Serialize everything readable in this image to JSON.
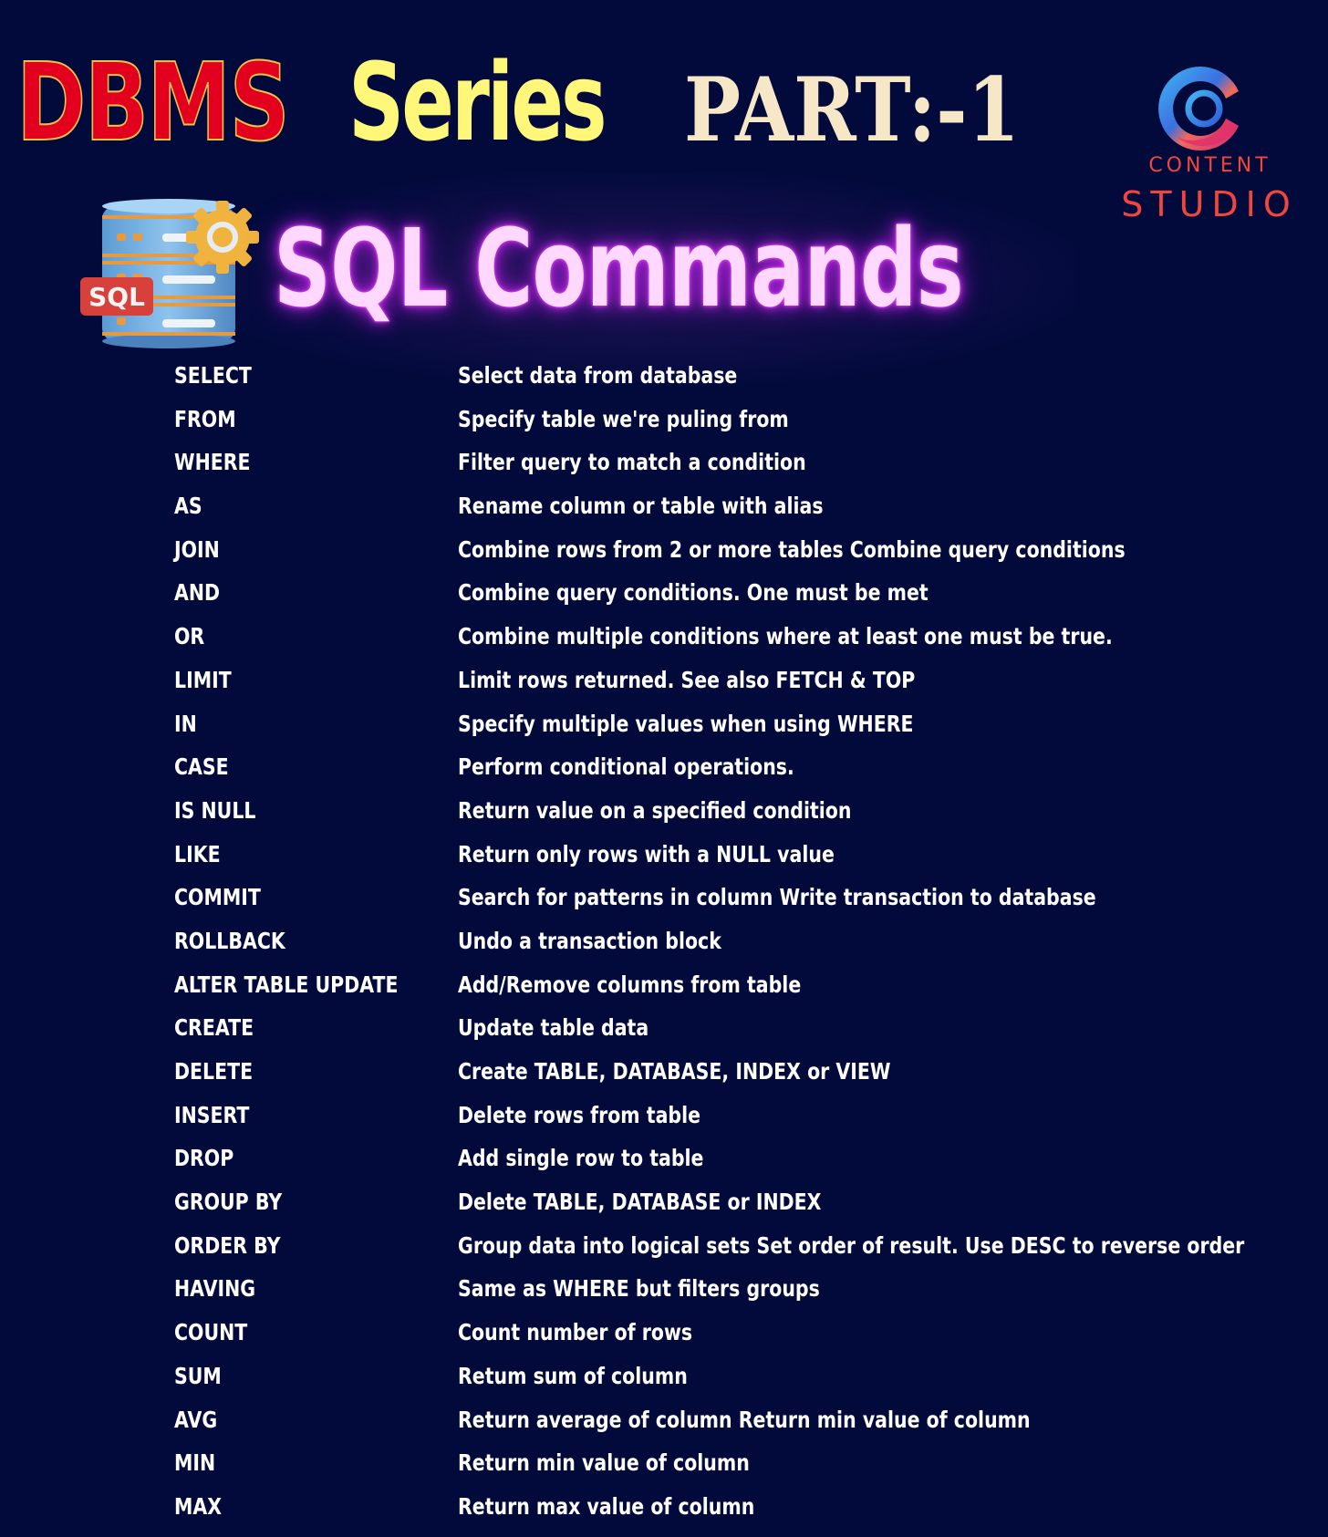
{
  "header": {
    "title_part1": "DBMS",
    "title_part2": "Series",
    "title_part3": "PART:-1",
    "colors": {
      "dbms": "#e3001f",
      "series": "#fff77a",
      "part": "#f6e7c6"
    }
  },
  "logo": {
    "icon": "content-studio-logo-icon",
    "line1": "CONTENT",
    "line2": "STUDIO",
    "color": "#f2453b"
  },
  "section": {
    "icon": "sql-database-gear-icon",
    "icon_badge": "SQL",
    "title": "SQL Commands",
    "title_color": "#ffd8ff",
    "glow_color": "#c02ee0"
  },
  "commands": [
    {
      "keyword": "SELECT",
      "description": "Select data from database"
    },
    {
      "keyword": "FROM",
      "description": "Specify table we're puling from"
    },
    {
      "keyword": "WHERE",
      "description": "Filter query to match a condition"
    },
    {
      "keyword": "AS",
      "description": "Rename column or table with alias"
    },
    {
      "keyword": "JOIN",
      "description": "Combine rows from 2 or more tables Combine query conditions"
    },
    {
      "keyword": "AND",
      "description": "Combine query conditions. One must be met"
    },
    {
      "keyword": "OR",
      "description": "Combine multiple conditions where at least one must be true."
    },
    {
      "keyword": "LIMIT",
      "description": "Limit rows returned. See also FETCH & TOP"
    },
    {
      "keyword": "IN",
      "description": "Specify multiple values when using WHERE"
    },
    {
      "keyword": "CASE",
      "description": "Perform conditional operations."
    },
    {
      "keyword": "IS NULL",
      "description": "Return value on a specified condition"
    },
    {
      "keyword": "LIKE",
      "description": "Return only rows with a NULL value"
    },
    {
      "keyword": "COMMIT",
      "description": "Search for patterns in column Write transaction to database"
    },
    {
      "keyword": "ROLLBACK",
      "description": "Undo a transaction block"
    },
    {
      "keyword": "ALTER TABLE UPDATE",
      "description": "Add/Remove columns from table"
    },
    {
      "keyword": "CREATE",
      "description": "Update table data"
    },
    {
      "keyword": "DELETE",
      "description": "Create TABLE, DATABASE, INDEX or VIEW"
    },
    {
      "keyword": "INSERT",
      "description": "Delete rows from table"
    },
    {
      "keyword": "DROP",
      "description": "Add single row to table"
    },
    {
      "keyword": "GROUP BY",
      "description": "Delete TABLE, DATABASE or INDEX"
    },
    {
      "keyword": "ORDER BY",
      "description": "Group data into logical sets Set order of result. Use DESC to reverse order"
    },
    {
      "keyword": "HAVING",
      "description": "Same as WHERE but filters groups"
    },
    {
      "keyword": "COUNT",
      "description": "Count number of rows"
    },
    {
      "keyword": "SUM",
      "description": "Retum sum of column"
    },
    {
      "keyword": "AVG",
      "description": "Return average of column Return min value of column"
    },
    {
      "keyword": "MIN",
      "description": "Return min value of column"
    },
    {
      "keyword": "MAX",
      "description": "Return max value of column"
    }
  ]
}
